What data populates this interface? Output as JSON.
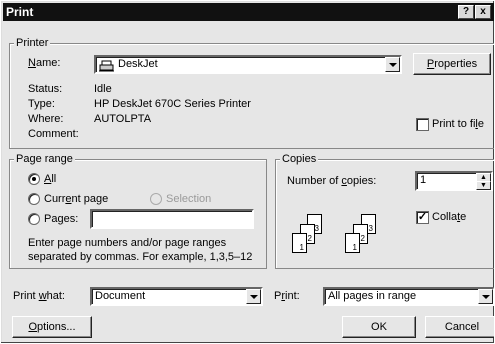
{
  "window": {
    "title": "Print",
    "help_glyph": "?",
    "close_glyph": "x"
  },
  "printer": {
    "legend": "Printer",
    "name_label": "Name:",
    "name_value": "DeskJet",
    "properties_label": "Properties",
    "status_label": "Status:",
    "status_value": "Idle",
    "type_label": "Type:",
    "type_value": "HP DeskJet 670C Series Printer",
    "where_label": "Where:",
    "where_value": "AUTOLPTA",
    "comment_label": "Comment:",
    "print_to_file_label": "Print to file",
    "print_to_file_checked": false
  },
  "page_range": {
    "legend": "Page range",
    "all_label": "All",
    "current_page_label": "Current page",
    "selection_label": "Selection",
    "pages_label": "Pages:",
    "pages_value": "",
    "selected": "all",
    "help_text_1": "Enter page numbers and/or page ranges",
    "help_text_2": "separated by commas.  For example, 1,3,5–12"
  },
  "copies": {
    "legend": "Copies",
    "number_label": "Number of copies:",
    "number_value": "1",
    "collate_label": "Collate",
    "collate_checked": true,
    "page_numbers": [
      "1",
      "2",
      "3"
    ]
  },
  "footer": {
    "print_what_label": "Print what:",
    "print_what_value": "Document",
    "print_label": "Print:",
    "print_value": "All pages in range",
    "options_label": "Options...",
    "ok_label": "OK",
    "cancel_label": "Cancel"
  }
}
